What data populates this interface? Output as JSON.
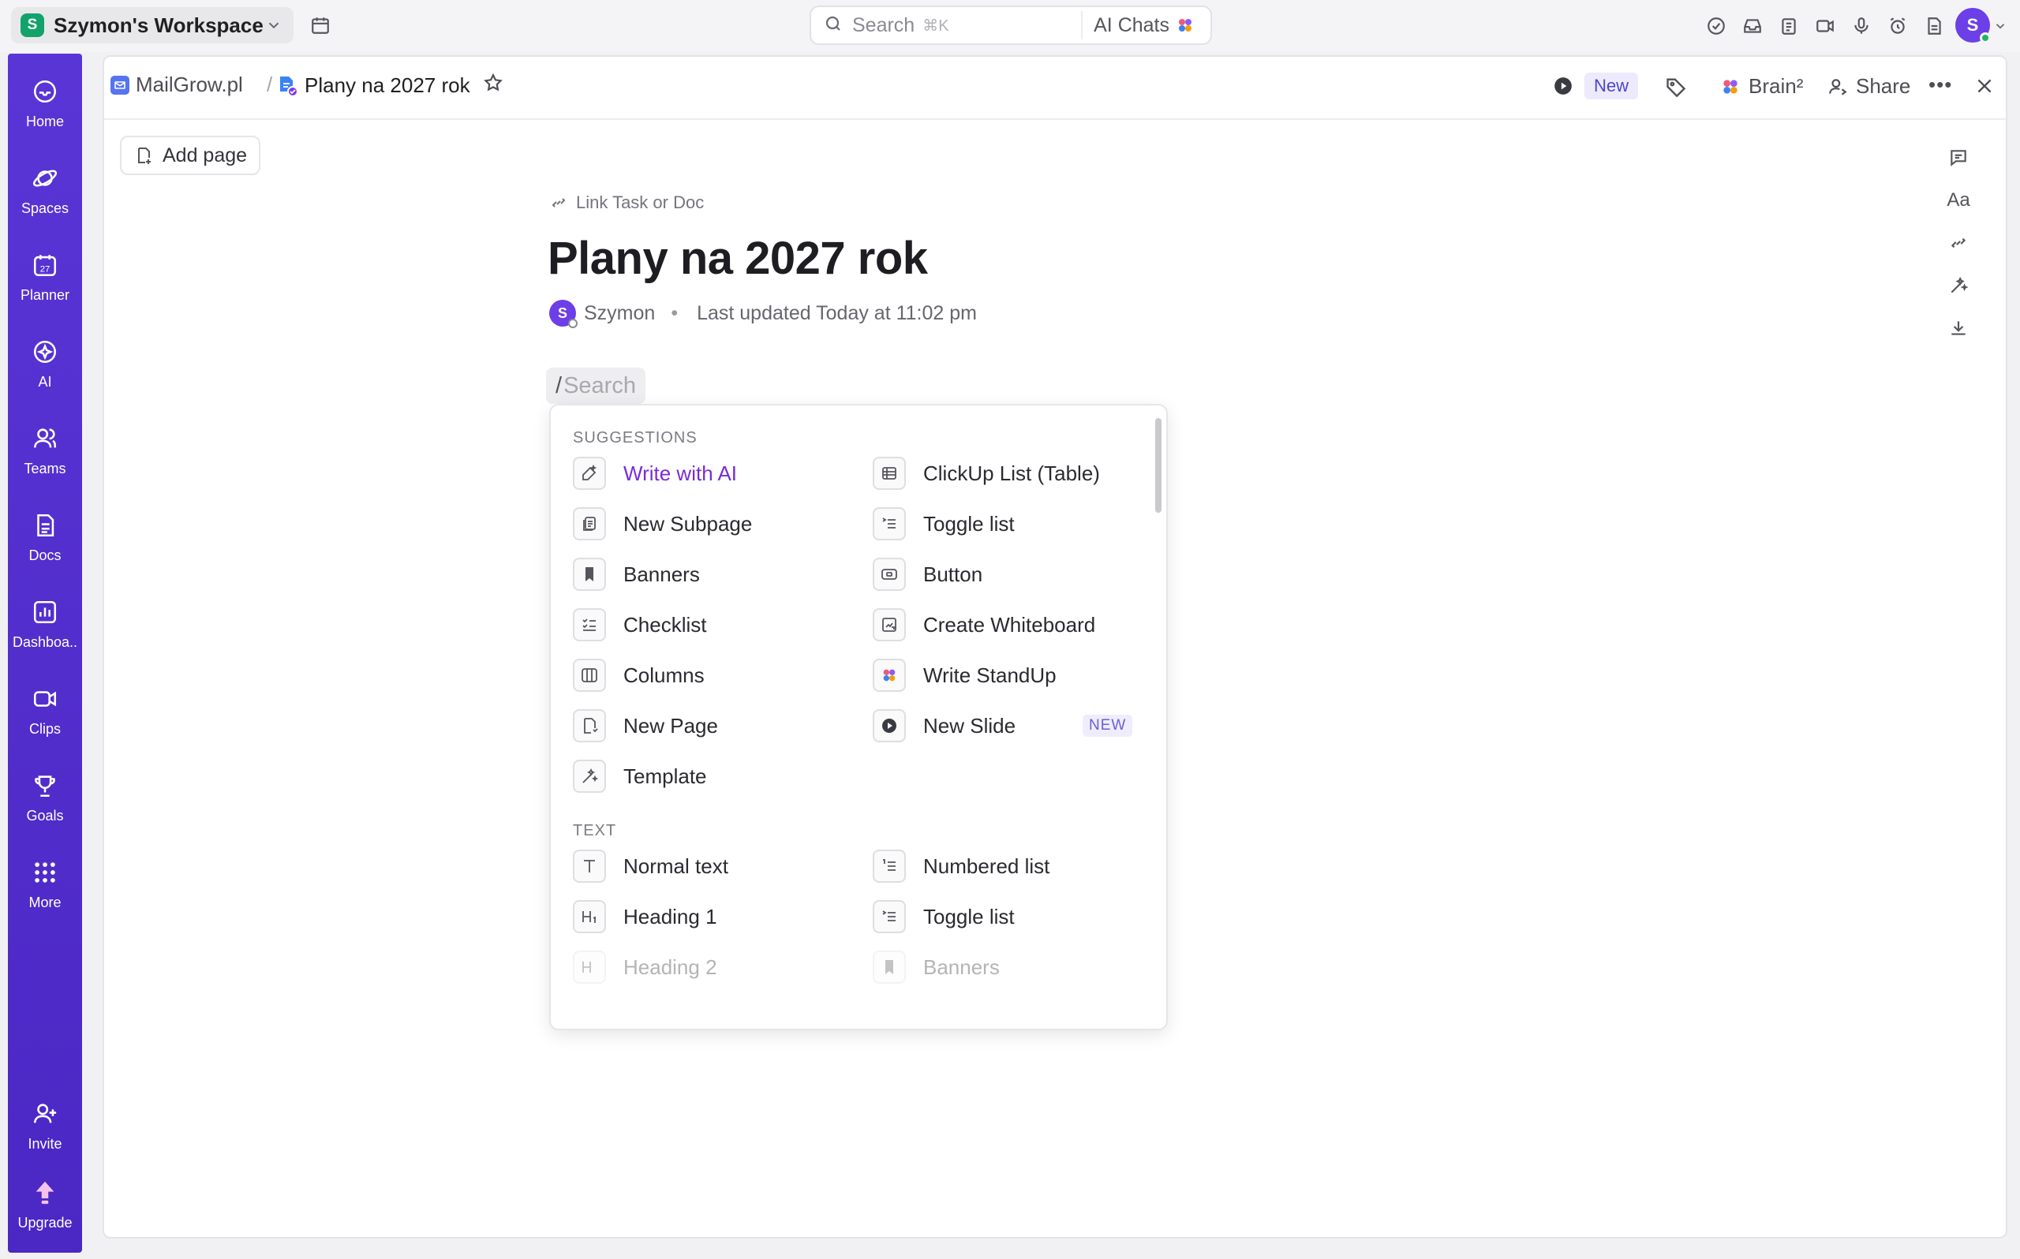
{
  "workspace": {
    "initial": "S",
    "name": "Szymon's Workspace"
  },
  "search": {
    "placeholder": "Search",
    "shortcut": "⌘K",
    "ai_chats": "AI Chats"
  },
  "user": {
    "initial": "S"
  },
  "sidebar": {
    "items": [
      {
        "label": "Home",
        "icon": "home-icon"
      },
      {
        "label": "Spaces",
        "icon": "planet-icon"
      },
      {
        "label": "Planner",
        "icon": "calendar-icon"
      },
      {
        "label": "AI",
        "icon": "ai-icon"
      },
      {
        "label": "Teams",
        "icon": "team-icon"
      },
      {
        "label": "Docs",
        "icon": "document-icon"
      },
      {
        "label": "Dashboa..",
        "icon": "chart-icon"
      },
      {
        "label": "Clips",
        "icon": "video-icon"
      },
      {
        "label": "Goals",
        "icon": "trophy-icon"
      },
      {
        "label": "More",
        "icon": "grid-icon"
      }
    ],
    "invite": "Invite",
    "upgrade": "Upgrade"
  },
  "breadcrumb": {
    "space": "MailGrow.pl",
    "doc": "Plany na 2027 rok"
  },
  "header": {
    "new_badge": "New",
    "brain": "Brain²",
    "share": "Share"
  },
  "page": {
    "add_page": "Add page",
    "link_task": "Link Task or Doc",
    "title": "Plany na 2027 rok",
    "author_initial": "S",
    "author": "Szymon",
    "meta_separator": "•",
    "last_updated": "Last updated Today at 11:02 pm",
    "slash_prefix": "/",
    "slash_placeholder": "Search"
  },
  "popup": {
    "suggestions_title": "SUGGESTIONS",
    "suggestions": [
      {
        "label": "Write with AI",
        "icon": "ai-write-icon"
      },
      {
        "label": "ClickUp List (Table)",
        "icon": "table-icon"
      },
      {
        "label": "New Subpage",
        "icon": "subpage-icon"
      },
      {
        "label": "Toggle list",
        "icon": "toggle-list-icon"
      },
      {
        "label": "Banners",
        "icon": "bookmark-icon"
      },
      {
        "label": "Button",
        "icon": "button-icon"
      },
      {
        "label": "Checklist",
        "icon": "checklist-icon"
      },
      {
        "label": "Create Whiteboard",
        "icon": "whiteboard-icon"
      },
      {
        "label": "Columns",
        "icon": "columns-icon"
      },
      {
        "label": "Write StandUp",
        "icon": "standup-icon"
      },
      {
        "label": "New Page",
        "icon": "new-page-icon"
      },
      {
        "label": "New Slide",
        "icon": "slide-icon",
        "tag": "NEW"
      },
      {
        "label": "Template",
        "icon": "template-icon"
      }
    ],
    "text_title": "TEXT",
    "text_items": [
      {
        "label": "Normal text",
        "icon": "text-icon"
      },
      {
        "label": "Numbered list",
        "icon": "numbered-list-icon"
      },
      {
        "label": "Heading 1",
        "icon": "heading-1-icon"
      },
      {
        "label": "Toggle list",
        "icon": "toggle-list-icon"
      },
      {
        "label": "Heading 2",
        "icon": "heading-2-icon"
      },
      {
        "label": "Banners",
        "icon": "bookmark-icon"
      }
    ]
  },
  "colors": {
    "sidebar": "#5a35d6",
    "accent": "#7a2bd8",
    "workspace_badge": "#12a36a",
    "avatar": "#6d3fe6"
  }
}
